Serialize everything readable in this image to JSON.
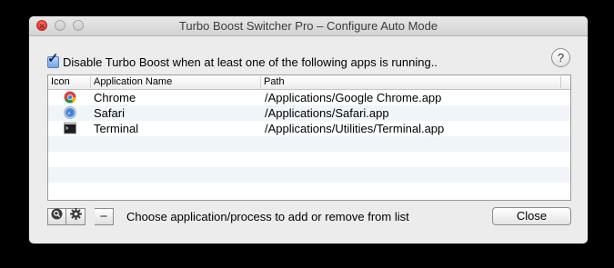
{
  "window": {
    "title": "Turbo Boost Switcher Pro – Configure Auto Mode"
  },
  "option": {
    "checked": true,
    "label": "Disable Turbo Boost when at least one of the following apps is running.."
  },
  "help": {
    "label": "?"
  },
  "table": {
    "columns": [
      "Icon",
      "Application Name",
      "Path"
    ],
    "rows": [
      {
        "icon": "chrome-icon",
        "name": "Chrome",
        "path": "/Applications/Google Chrome.app"
      },
      {
        "icon": "safari-icon",
        "name": "Safari",
        "path": "/Applications/Safari.app"
      },
      {
        "icon": "terminal-icon",
        "name": "Terminal",
        "path": "/Applications/Utilities/Terminal.app"
      }
    ],
    "alt_row_color": "#f1f5fa"
  },
  "toolbar": {
    "search_icon": "search-icon",
    "settings_icon": "gear-icon",
    "remove_label": "−",
    "hint": "Choose application/process to add or remove from list"
  },
  "close_button": {
    "label": "Close"
  },
  "colors": {
    "close_light": "#d8342b",
    "checkbox_blue": "#6ea5ea"
  }
}
